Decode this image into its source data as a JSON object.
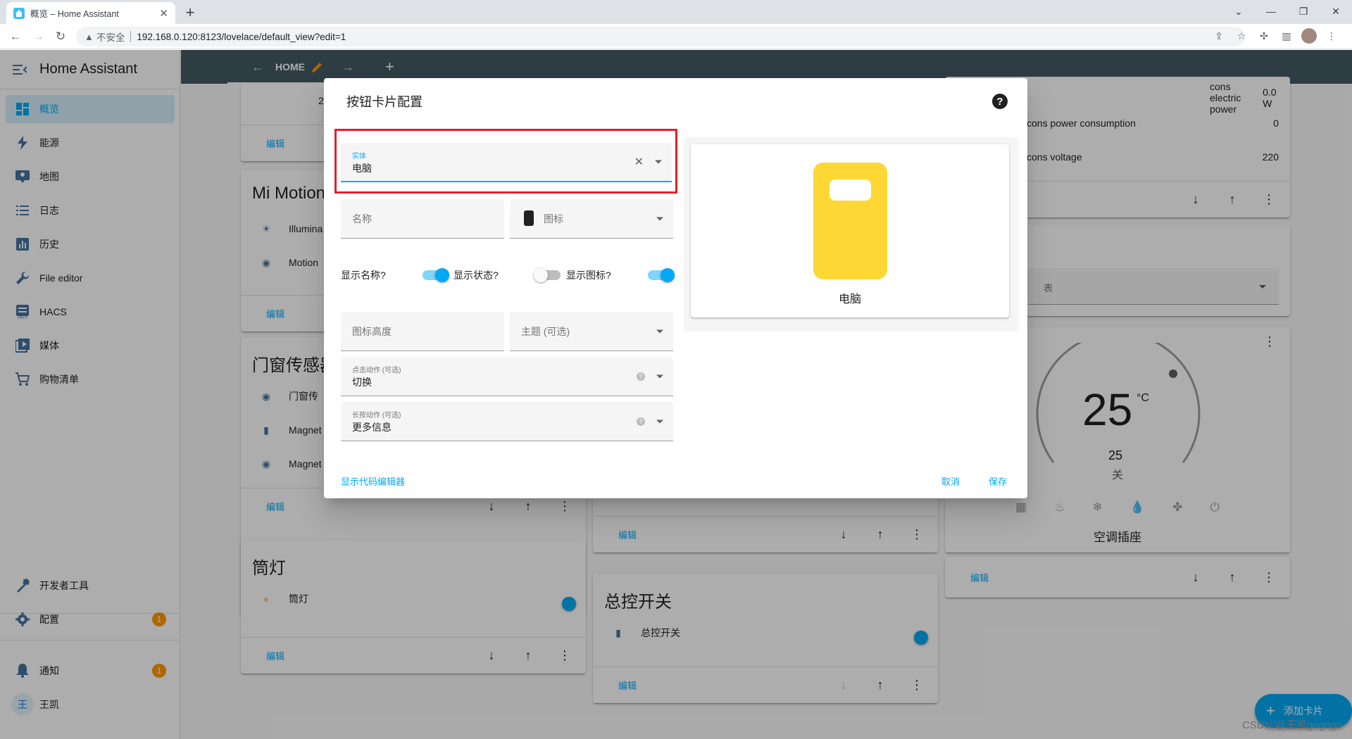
{
  "browser": {
    "tab_title": "概览 – Home Assistant",
    "insecure_label": "不安全",
    "url": "192.168.0.120:8123/lovelace/default_view?edit=1"
  },
  "sidebar": {
    "app_name": "Home Assistant",
    "items": [
      {
        "label": "概览",
        "icon": "dashboard-icon",
        "active": true
      },
      {
        "label": "能源",
        "icon": "lightning-icon"
      },
      {
        "label": "地图",
        "icon": "map-icon"
      },
      {
        "label": "日志",
        "icon": "list-icon"
      },
      {
        "label": "历史",
        "icon": "chart-icon"
      },
      {
        "label": "File editor",
        "icon": "wrench-icon"
      },
      {
        "label": "HACS",
        "icon": "hacs-icon"
      },
      {
        "label": "媒体",
        "icon": "media-icon"
      },
      {
        "label": "购物清单",
        "icon": "cart-icon"
      }
    ],
    "bottom_items": [
      {
        "label": "开发者工具",
        "icon": "hammer-icon"
      },
      {
        "label": "配置",
        "icon": "gear-icon",
        "badge": "1"
      },
      {
        "label": "通知",
        "icon": "bell-icon",
        "badge": "1"
      },
      {
        "label": "王凯",
        "avatar": "王"
      }
    ]
  },
  "topbar": {
    "view_label": "HOME"
  },
  "cards": {
    "top_left_value": "2",
    "edit_label": "编辑",
    "mi_motion": {
      "title": "Mi Motion",
      "rows": [
        "Illumina",
        "Motion"
      ]
    },
    "door": {
      "title": "门窗传感器",
      "rows": [
        "门窗传",
        "Magnet",
        "Magnet"
      ]
    },
    "downlight": {
      "title": "筒灯",
      "row": "筒灯"
    },
    "master_switch": {
      "title": "总控开关",
      "row": "总控开关"
    },
    "right_top": {
      "rows": [
        {
          "label": "cons electric power",
          "value": "0.0 W"
        },
        {
          "label": "cons power consumption",
          "value": "0"
        },
        {
          "label": "cons voltage",
          "value": "220"
        }
      ]
    },
    "right_select": {
      "value": "表"
    },
    "thermostat": {
      "temperature": "25",
      "unit": "°C",
      "target": "25",
      "state": "关",
      "name": "空调插座"
    }
  },
  "dialog": {
    "title": "按钮卡片配置",
    "entity_label": "实体",
    "entity_value": "电脑",
    "name_placeholder": "名称",
    "icon_placeholder": "图标",
    "show_name": "显示名称?",
    "show_state": "显示状态?",
    "show_icon": "显示图标?",
    "icon_height_placeholder": "图标高度",
    "theme_placeholder": "主题 (可选)",
    "tap_action_label": "点击动作 (可选)",
    "tap_action_value": "切换",
    "hold_action_label": "长按动作 (可选)",
    "hold_action_value": "更多信息",
    "code_editor_link": "显示代码编辑器",
    "cancel": "取消",
    "save": "保存",
    "preview_name": "电脑",
    "preview_icon_color": "#fdd835"
  },
  "fab": {
    "label": "添加卡片"
  },
  "watermark": "CSDN @王凯gogogo",
  "colors": {
    "accent": "#03a9f4",
    "header": "#455a64",
    "badge": "#ff9800",
    "highlight": "#e0202a"
  }
}
